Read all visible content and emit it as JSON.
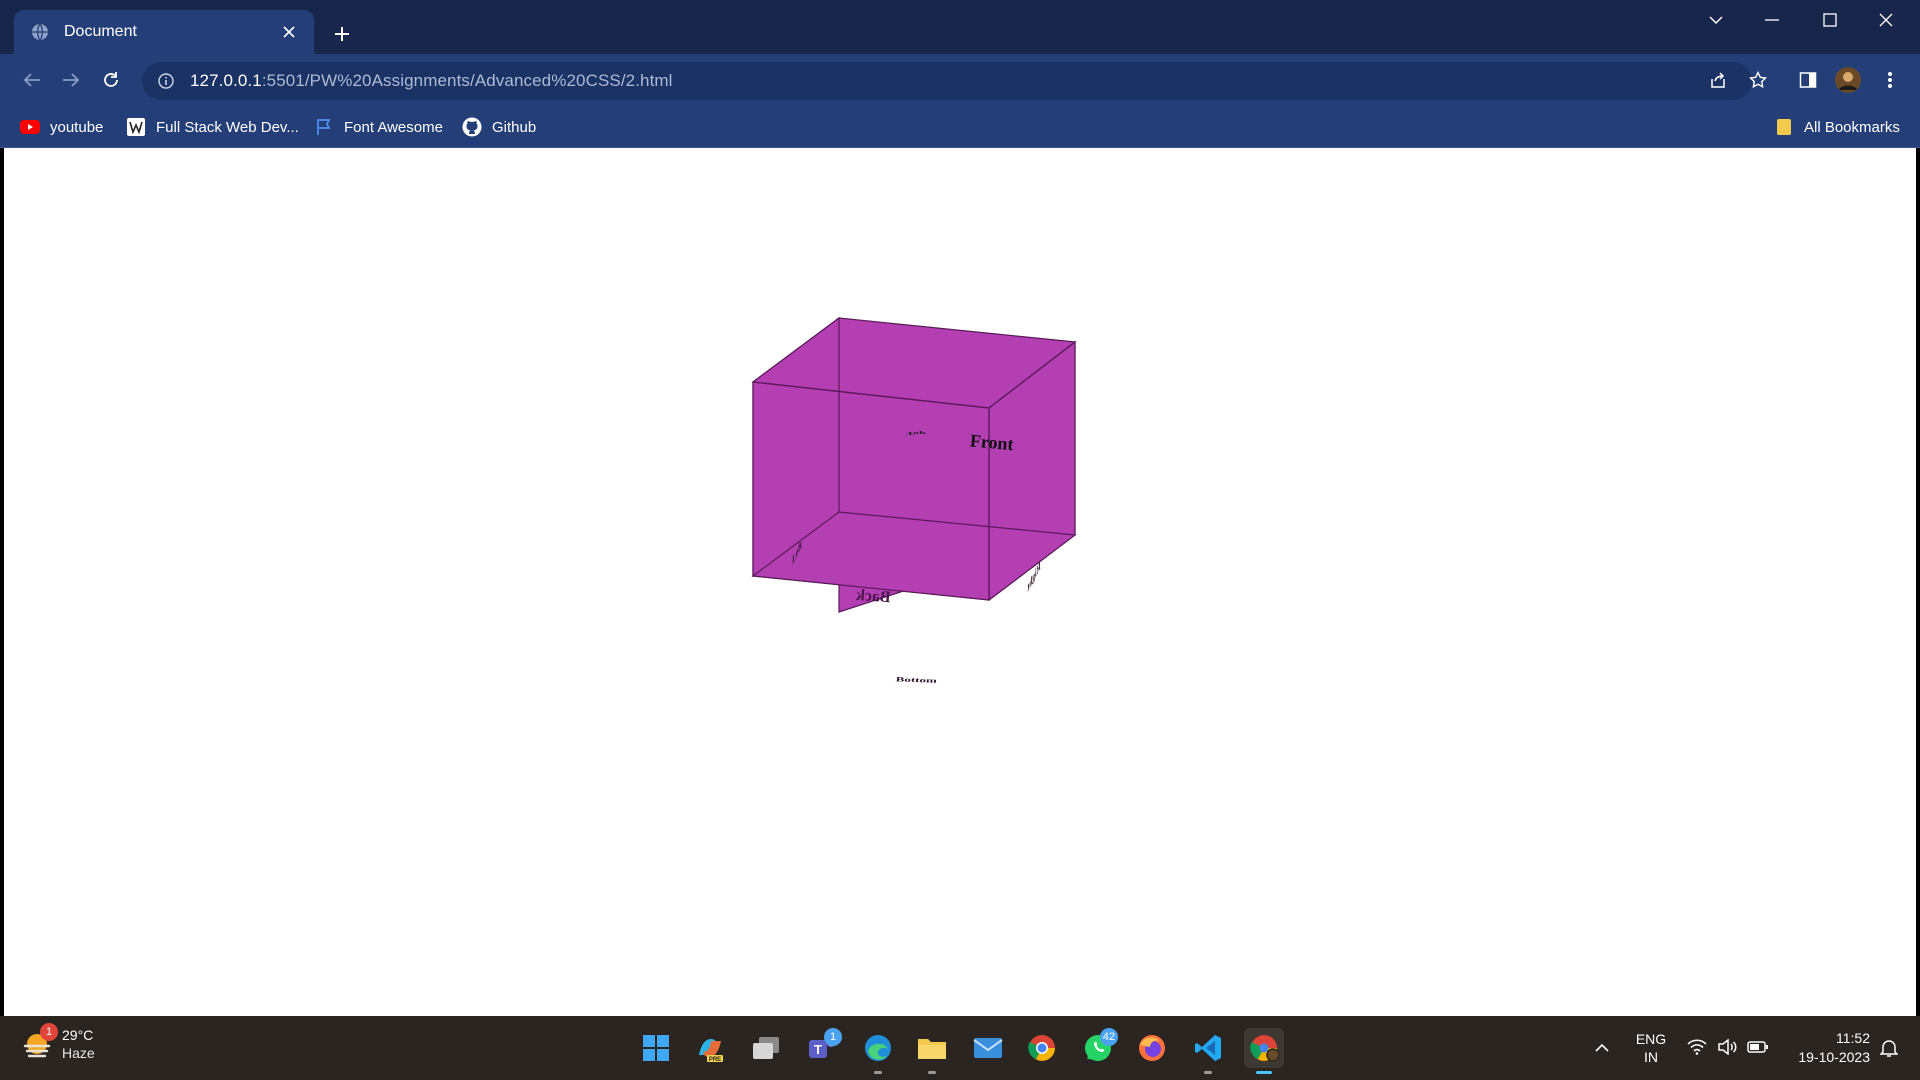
{
  "browser": {
    "tab_title": "Document",
    "url_host": "127.0.0.1",
    "url_rest": ":5501/PW%20Assignments/Advanced%20CSS/2.html",
    "bookmarks": [
      {
        "label": "youtube",
        "icon": "youtube-icon"
      },
      {
        "label": "Full Stack Web Dev...",
        "icon": "site-icon"
      },
      {
        "label": "Font Awesome",
        "icon": "flag-icon"
      },
      {
        "label": "Github",
        "icon": "github-icon"
      }
    ],
    "all_bookmarks_label": "All Bookmarks",
    "accent": "#243f78",
    "tabstrip_color": "#17264a"
  },
  "page": {
    "cube": {
      "faces": [
        "Top",
        "Front",
        "Left",
        "Back",
        "Right",
        "Bottom"
      ],
      "face_color": "#b43fb3",
      "edge_color": "#5a1a59"
    }
  },
  "taskbar": {
    "weather": {
      "temp": "29°C",
      "condition": "Haze",
      "badge": "1"
    },
    "apps": [
      {
        "name": "start-icon"
      },
      {
        "name": "copilot-icon",
        "tag": "PRE"
      },
      {
        "name": "task-view-icon"
      },
      {
        "name": "teams-icon",
        "badge": "1"
      },
      {
        "name": "edge-icon"
      },
      {
        "name": "file-explorer-icon"
      },
      {
        "name": "mail-icon"
      },
      {
        "name": "chrome-icon"
      },
      {
        "name": "whatsapp-icon",
        "badge": "42"
      },
      {
        "name": "firefox-icon"
      },
      {
        "name": "vscode-icon"
      },
      {
        "name": "chrome-profile-icon"
      }
    ],
    "lang_top": "ENG",
    "lang_bottom": "IN",
    "time": "11:52",
    "date": "19-10-2023"
  }
}
